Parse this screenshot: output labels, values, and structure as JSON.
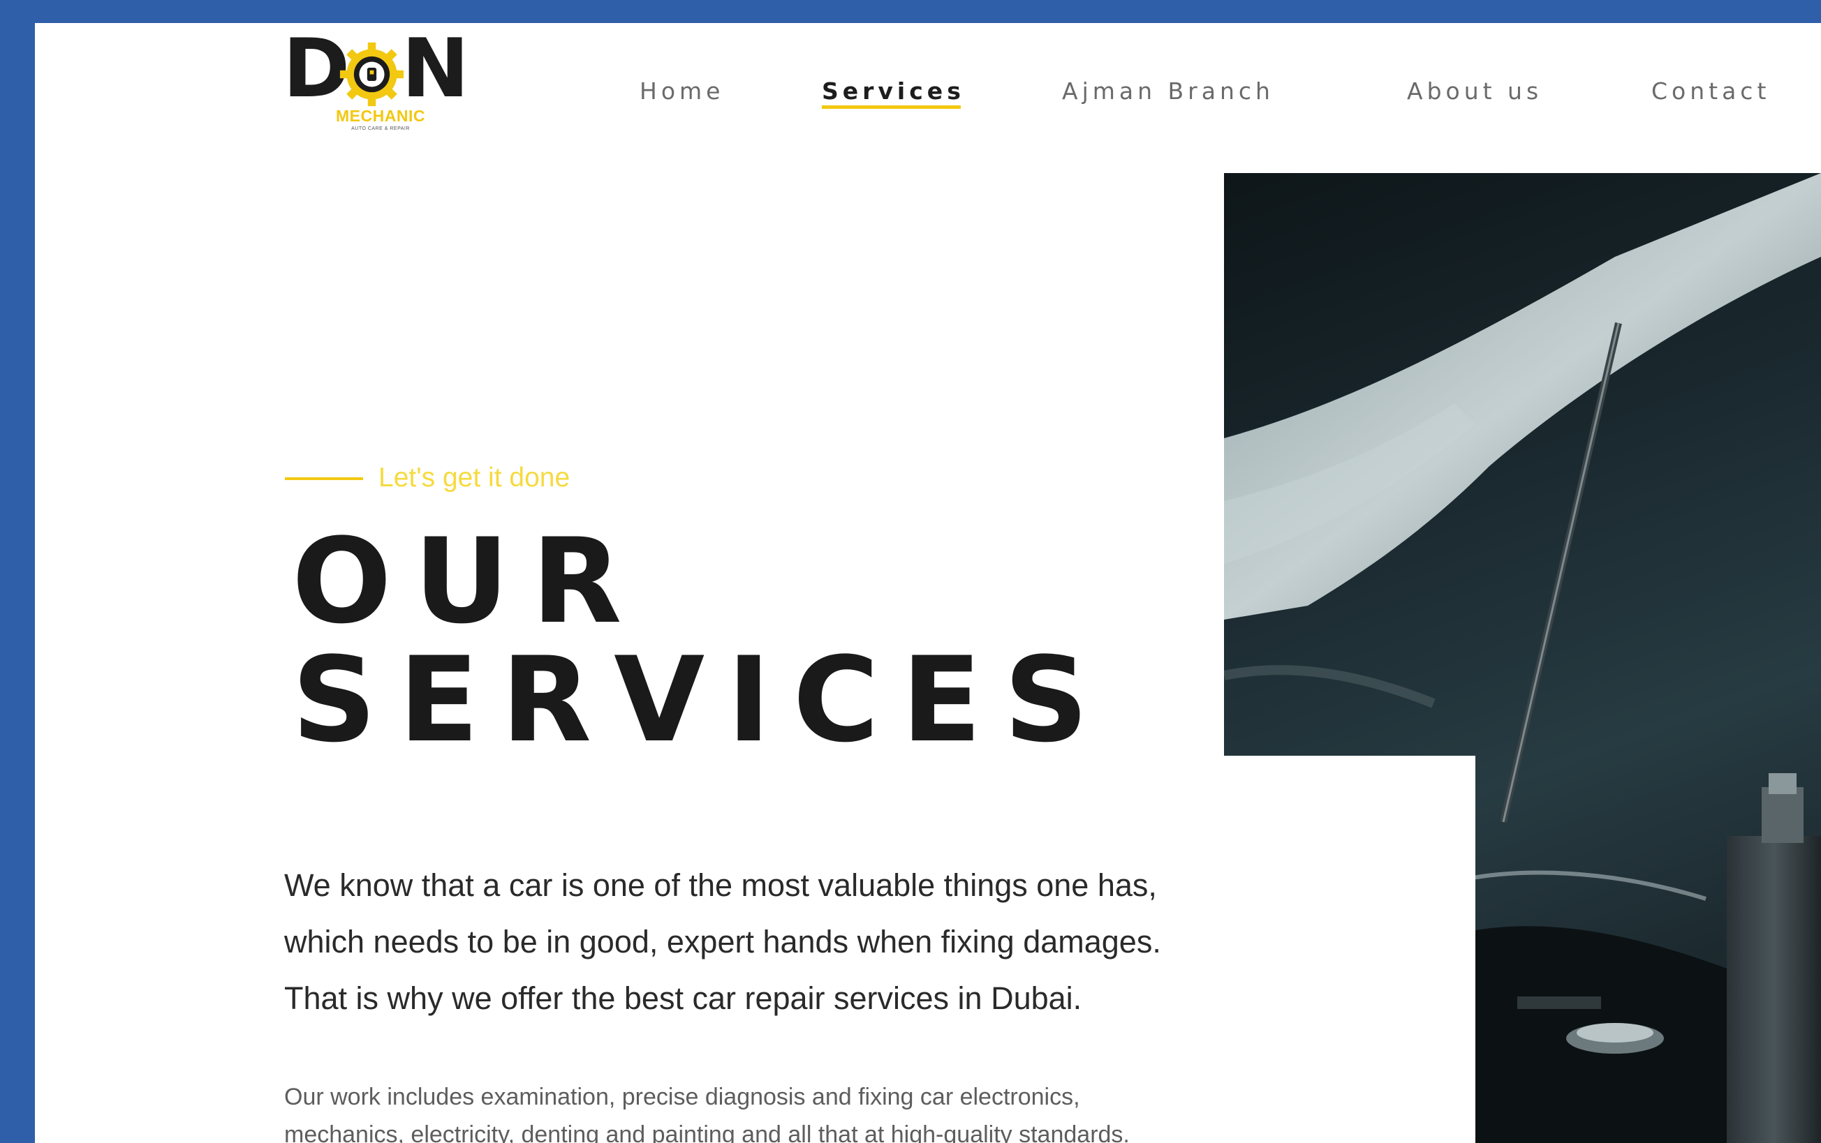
{
  "logo": {
    "word_left": "D",
    "word_right": "N",
    "sub": "MECHANIC",
    "tagline": "AUTO CARE & REPAIR"
  },
  "nav": [
    {
      "label": "Home",
      "active": false
    },
    {
      "label": "Services",
      "active": true
    },
    {
      "label": "Ajman Branch",
      "active": false
    },
    {
      "label": "About us",
      "active": false
    },
    {
      "label": "Contact",
      "active": false
    }
  ],
  "hero": {
    "tagline": "Let's get it done",
    "title_line1": "OUR",
    "title_line2": "SERVICES",
    "lead": [
      "We know that a car is one of the most valuable things one has,",
      "which needs to be in good, expert hands when fixing damages.",
      "That is why we offer the best car repair services in Dubai."
    ],
    "body": [
      "Our work includes examination, precise diagnosis and fixing car electronics,",
      "mechanics, electricity, denting and painting and all that at high-quality standards."
    ]
  },
  "colors": {
    "frame": "#2f5fa8",
    "accent": "#f2c811",
    "text": "#1a1a1a"
  },
  "icons": {
    "logo_gear": "gear-icon"
  }
}
